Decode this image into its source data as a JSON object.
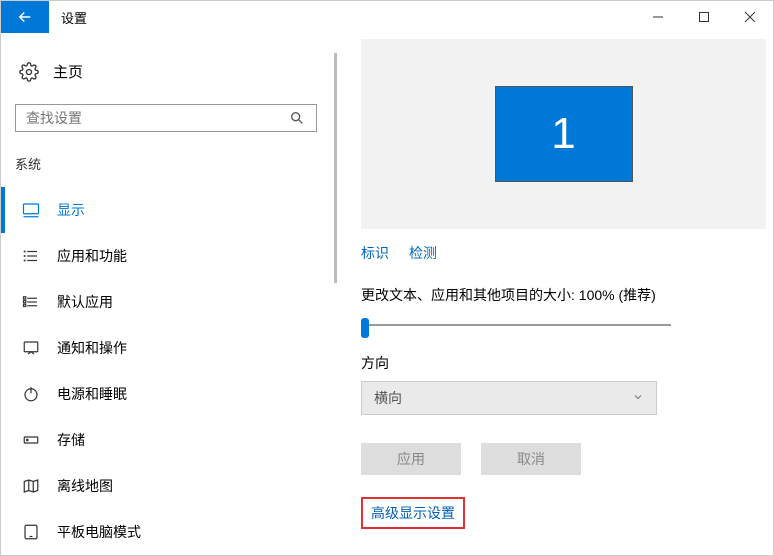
{
  "titlebar": {
    "back_label": "←",
    "title": "设置"
  },
  "sidebar": {
    "home": "主页",
    "search_placeholder": "查找设置",
    "section": "系统",
    "items": [
      {
        "label": "显示",
        "selected": true,
        "icon": "monitor"
      },
      {
        "label": "应用和功能",
        "selected": false,
        "icon": "list"
      },
      {
        "label": "默认应用",
        "selected": false,
        "icon": "defaults"
      },
      {
        "label": "通知和操作",
        "selected": false,
        "icon": "notify"
      },
      {
        "label": "电源和睡眠",
        "selected": false,
        "icon": "power"
      },
      {
        "label": "存储",
        "selected": false,
        "icon": "storage"
      },
      {
        "label": "离线地图",
        "selected": false,
        "icon": "map"
      },
      {
        "label": "平板电脑模式",
        "selected": false,
        "icon": "tablet"
      }
    ]
  },
  "main": {
    "monitor_number": "1",
    "identify": "标识",
    "detect": "检测",
    "scale_label": "更改文本、应用和其他项目的大小: 100% (推荐)",
    "orientation_label": "方向",
    "orientation_value": "横向",
    "apply": "应用",
    "cancel": "取消",
    "advanced": "高级显示设置"
  }
}
